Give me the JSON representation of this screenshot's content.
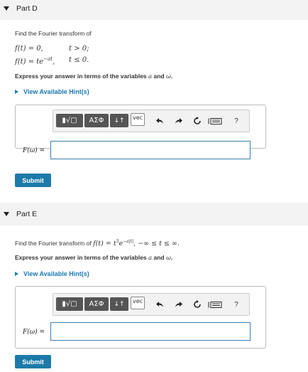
{
  "partD": {
    "title": "Part D",
    "prompt": "Find the Fourier transform of",
    "line1_lhs": "f(t) = 0,",
    "line1_cond": "t > 0;",
    "line2_lhs_a": "f(t) = te",
    "line2_exp": "−at",
    "line2_comma": ",",
    "line2_cond": "t ≤ 0.",
    "instruction_a": "Express your answer in terms of the variables ",
    "var_a": "a",
    "instruction_and": " and ",
    "var_w": "ω",
    "instruction_end": ".",
    "hint": "View Available Hint(s)",
    "answer_label": "F(ω) =",
    "answer_value": "",
    "submit": "Submit"
  },
  "partE": {
    "title": "Part E",
    "prompt_a": "Find the Fourier transform of ",
    "func_a": "f(t) = t",
    "func_sup3": "3",
    "func_e": "e",
    "func_exp": "−a|t|",
    "func_range": ", −∞ ≤ t ≤ ∞.",
    "instruction_a": "Express your answer in terms of the variables ",
    "var_a": "a",
    "instruction_and": " and ",
    "var_w": "ω",
    "instruction_end": ".",
    "hint": "View Available Hint(s)",
    "answer_label": "F(ω) =",
    "answer_value": "",
    "submit": "Submit"
  },
  "toolbar": {
    "templates": "▮√▢",
    "greek": "ΑΣΦ",
    "arrows": "↓↑",
    "vec": "vec",
    "help": "?"
  },
  "icons": [
    "undo-icon",
    "redo-icon",
    "reset-icon",
    "keyboard-icon",
    "help-icon"
  ],
  "colors": {
    "accent": "#1a7ab3",
    "submit": "#1c7aa8",
    "input_border": "#3a7fb0"
  }
}
